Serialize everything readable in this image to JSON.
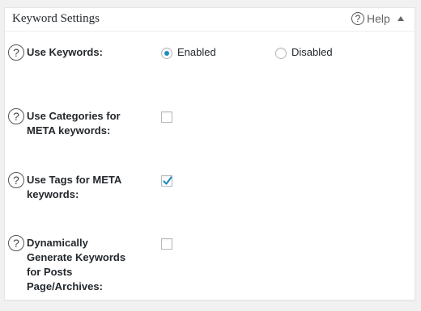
{
  "panel": {
    "title": "Keyword Settings",
    "help_label": "Help",
    "help_glyph": "?"
  },
  "rows": [
    {
      "label": "Use Keywords:",
      "type": "radio",
      "options": [
        {
          "label": "Enabled",
          "checked": true
        },
        {
          "label": "Disabled",
          "checked": false
        }
      ]
    },
    {
      "label": "Use Categories for META keywords:",
      "type": "checkbox",
      "checked": false
    },
    {
      "label": "Use Tags for META keywords:",
      "type": "checkbox",
      "checked": true
    },
    {
      "label": "Dynamically Generate Keywords for Posts Page/Archives:",
      "type": "checkbox",
      "checked": false
    }
  ],
  "colors": {
    "accent": "#1e8cbe",
    "panel_bg": "#ffffff",
    "page_bg": "#f1f1f1"
  }
}
